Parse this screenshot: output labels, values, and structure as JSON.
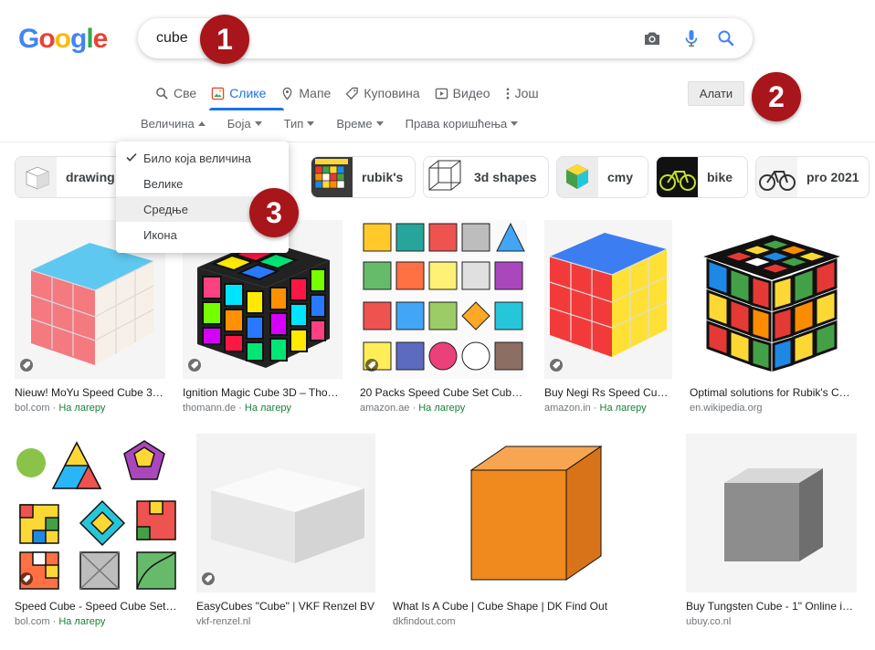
{
  "header": {
    "logo_letters": [
      {
        "ch": "G",
        "color": "#4285F4"
      },
      {
        "ch": "o",
        "color": "#EA4335"
      },
      {
        "ch": "o",
        "color": "#FBBC05"
      },
      {
        "ch": "g",
        "color": "#4285F4"
      },
      {
        "ch": "l",
        "color": "#34A853"
      },
      {
        "ch": "e",
        "color": "#EA4335"
      }
    ],
    "search_value": "cube"
  },
  "callouts": [
    "1",
    "2",
    "3"
  ],
  "tabs": [
    {
      "label": "Све",
      "icon": "search-icon"
    },
    {
      "label": "Слике",
      "icon": "image-icon",
      "active": true
    },
    {
      "label": "Мапе",
      "icon": "map-pin-icon"
    },
    {
      "label": "Куповина",
      "icon": "tag-icon"
    },
    {
      "label": "Видео",
      "icon": "video-icon"
    },
    {
      "label": "Још",
      "icon": "more-vertical-icon"
    }
  ],
  "tools_label": "Алати",
  "filters": [
    {
      "label": "Величина",
      "open": true
    },
    {
      "label": "Боја"
    },
    {
      "label": "Тип"
    },
    {
      "label": "Време"
    },
    {
      "label": "Права коришћења"
    }
  ],
  "size_menu": {
    "items": [
      "Било која величина",
      "Велике",
      "Средње",
      "Икона"
    ],
    "selected": 0,
    "hovered": 2
  },
  "chips": [
    "drawing",
    "rubik's",
    "3d shapes",
    "cmy",
    "bike",
    "pro 2021"
  ],
  "results_row1": [
    {
      "title": "Nieuw! MoYu Speed Cube 3…",
      "source": "bol.com",
      "stock": "На лагеру"
    },
    {
      "title": "Ignition Magic Cube 3D – Tho…",
      "source": "thomann.de",
      "stock": "На лагеру"
    },
    {
      "title": "20 Packs Speed Cube Set Cub…",
      "source": "amazon.ae",
      "stock": "На лагеру"
    },
    {
      "title": "Buy Negi Rs Speed Cub…",
      "source": "amazon.in",
      "stock": "На лагеру"
    },
    {
      "title": "Optimal solutions for Rubik's C…",
      "source": "en.wikipedia.org",
      "stock": ""
    }
  ],
  "results_row2": [
    {
      "title": "Speed Cube - Speed Cube Set …",
      "source": "bol.com",
      "stock": "На лагеру"
    },
    {
      "title": "EasyCubes \"Cube\" | VKF Renzel BV",
      "source": "vkf-renzel.nl",
      "stock": ""
    },
    {
      "title": "What Is A Cube | Cube Shape | DK Find Out",
      "source": "dkfindout.com",
      "stock": ""
    },
    {
      "title": "Buy Tungsten Cube - 1\" Online in …",
      "source": "ubuy.co.nl",
      "stock": ""
    }
  ],
  "stock_separator": " · ",
  "colors": {
    "accent": "#1a73e8",
    "callout": "#a8151b",
    "in_stock": "#188038"
  }
}
